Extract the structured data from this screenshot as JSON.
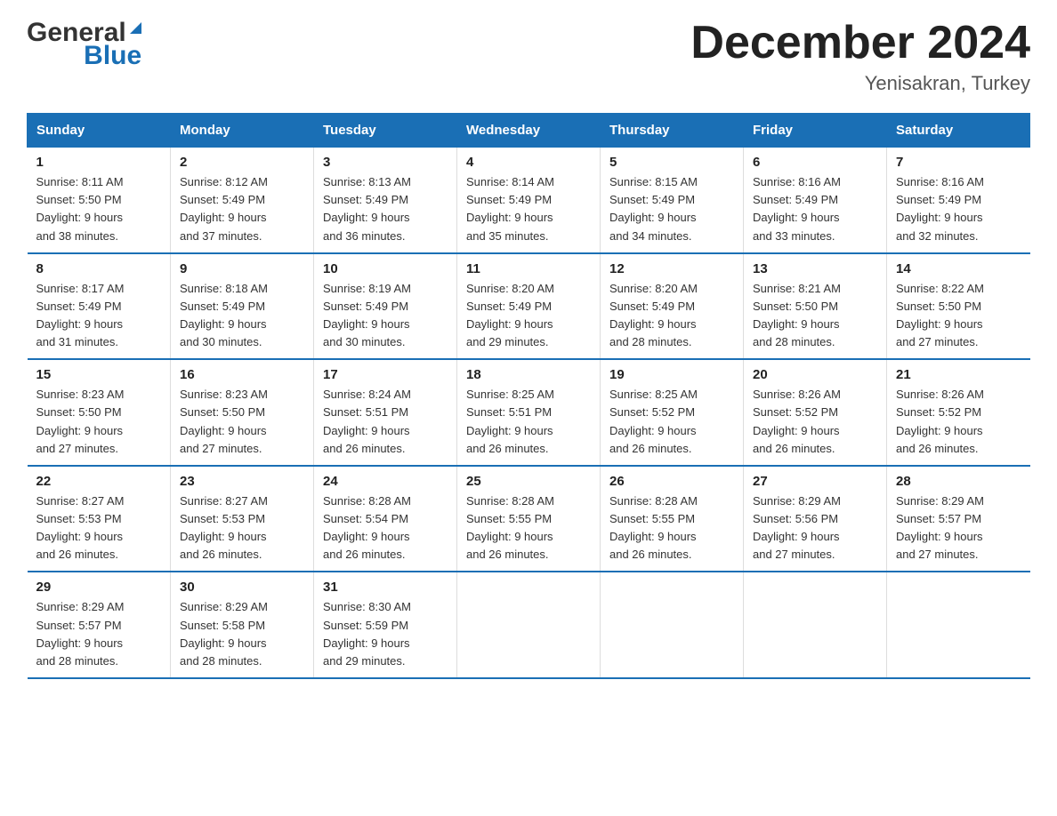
{
  "header": {
    "title": "December 2024",
    "subtitle": "Yenisakran, Turkey",
    "logo_general": "General",
    "logo_blue": "Blue"
  },
  "weekdays": [
    "Sunday",
    "Monday",
    "Tuesday",
    "Wednesday",
    "Thursday",
    "Friday",
    "Saturday"
  ],
  "weeks": [
    [
      {
        "day": "1",
        "sunrise": "8:11 AM",
        "sunset": "5:50 PM",
        "daylight": "9 hours and 38 minutes."
      },
      {
        "day": "2",
        "sunrise": "8:12 AM",
        "sunset": "5:49 PM",
        "daylight": "9 hours and 37 minutes."
      },
      {
        "day": "3",
        "sunrise": "8:13 AM",
        "sunset": "5:49 PM",
        "daylight": "9 hours and 36 minutes."
      },
      {
        "day": "4",
        "sunrise": "8:14 AM",
        "sunset": "5:49 PM",
        "daylight": "9 hours and 35 minutes."
      },
      {
        "day": "5",
        "sunrise": "8:15 AM",
        "sunset": "5:49 PM",
        "daylight": "9 hours and 34 minutes."
      },
      {
        "day": "6",
        "sunrise": "8:16 AM",
        "sunset": "5:49 PM",
        "daylight": "9 hours and 33 minutes."
      },
      {
        "day": "7",
        "sunrise": "8:16 AM",
        "sunset": "5:49 PM",
        "daylight": "9 hours and 32 minutes."
      }
    ],
    [
      {
        "day": "8",
        "sunrise": "8:17 AM",
        "sunset": "5:49 PM",
        "daylight": "9 hours and 31 minutes."
      },
      {
        "day": "9",
        "sunrise": "8:18 AM",
        "sunset": "5:49 PM",
        "daylight": "9 hours and 30 minutes."
      },
      {
        "day": "10",
        "sunrise": "8:19 AM",
        "sunset": "5:49 PM",
        "daylight": "9 hours and 30 minutes."
      },
      {
        "day": "11",
        "sunrise": "8:20 AM",
        "sunset": "5:49 PM",
        "daylight": "9 hours and 29 minutes."
      },
      {
        "day": "12",
        "sunrise": "8:20 AM",
        "sunset": "5:49 PM",
        "daylight": "9 hours and 28 minutes."
      },
      {
        "day": "13",
        "sunrise": "8:21 AM",
        "sunset": "5:50 PM",
        "daylight": "9 hours and 28 minutes."
      },
      {
        "day": "14",
        "sunrise": "8:22 AM",
        "sunset": "5:50 PM",
        "daylight": "9 hours and 27 minutes."
      }
    ],
    [
      {
        "day": "15",
        "sunrise": "8:23 AM",
        "sunset": "5:50 PM",
        "daylight": "9 hours and 27 minutes."
      },
      {
        "day": "16",
        "sunrise": "8:23 AM",
        "sunset": "5:50 PM",
        "daylight": "9 hours and 27 minutes."
      },
      {
        "day": "17",
        "sunrise": "8:24 AM",
        "sunset": "5:51 PM",
        "daylight": "9 hours and 26 minutes."
      },
      {
        "day": "18",
        "sunrise": "8:25 AM",
        "sunset": "5:51 PM",
        "daylight": "9 hours and 26 minutes."
      },
      {
        "day": "19",
        "sunrise": "8:25 AM",
        "sunset": "5:52 PM",
        "daylight": "9 hours and 26 minutes."
      },
      {
        "day": "20",
        "sunrise": "8:26 AM",
        "sunset": "5:52 PM",
        "daylight": "9 hours and 26 minutes."
      },
      {
        "day": "21",
        "sunrise": "8:26 AM",
        "sunset": "5:52 PM",
        "daylight": "9 hours and 26 minutes."
      }
    ],
    [
      {
        "day": "22",
        "sunrise": "8:27 AM",
        "sunset": "5:53 PM",
        "daylight": "9 hours and 26 minutes."
      },
      {
        "day": "23",
        "sunrise": "8:27 AM",
        "sunset": "5:53 PM",
        "daylight": "9 hours and 26 minutes."
      },
      {
        "day": "24",
        "sunrise": "8:28 AM",
        "sunset": "5:54 PM",
        "daylight": "9 hours and 26 minutes."
      },
      {
        "day": "25",
        "sunrise": "8:28 AM",
        "sunset": "5:55 PM",
        "daylight": "9 hours and 26 minutes."
      },
      {
        "day": "26",
        "sunrise": "8:28 AM",
        "sunset": "5:55 PM",
        "daylight": "9 hours and 26 minutes."
      },
      {
        "day": "27",
        "sunrise": "8:29 AM",
        "sunset": "5:56 PM",
        "daylight": "9 hours and 27 minutes."
      },
      {
        "day": "28",
        "sunrise": "8:29 AM",
        "sunset": "5:57 PM",
        "daylight": "9 hours and 27 minutes."
      }
    ],
    [
      {
        "day": "29",
        "sunrise": "8:29 AM",
        "sunset": "5:57 PM",
        "daylight": "9 hours and 28 minutes."
      },
      {
        "day": "30",
        "sunrise": "8:29 AM",
        "sunset": "5:58 PM",
        "daylight": "9 hours and 28 minutes."
      },
      {
        "day": "31",
        "sunrise": "8:30 AM",
        "sunset": "5:59 PM",
        "daylight": "9 hours and 29 minutes."
      },
      null,
      null,
      null,
      null
    ]
  ],
  "labels": {
    "sunrise": "Sunrise:",
    "sunset": "Sunset:",
    "daylight": "Daylight:"
  },
  "colors": {
    "header_bg": "#1a6fb5",
    "border": "#1a6fb5"
  }
}
